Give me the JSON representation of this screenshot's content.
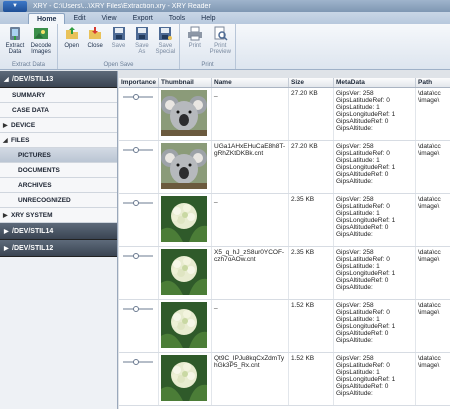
{
  "window": {
    "title": "XRY - C:\\Users\\...\\XRY Files\\Extraction.xry - XRY Reader"
  },
  "tabs": [
    {
      "label": "Home",
      "active": true
    },
    {
      "label": "Edit"
    },
    {
      "label": "View"
    },
    {
      "label": "Export"
    },
    {
      "label": "Tools"
    },
    {
      "label": "Help"
    }
  ],
  "ribbon": {
    "extract_group": {
      "label": "Extract Data",
      "buttons": [
        {
          "label": "Extract Data",
          "icon": "extract-data-icon"
        },
        {
          "label": "Decode Images",
          "icon": "decode-images-icon"
        }
      ]
    },
    "opensave_group": {
      "label": "Open Save",
      "buttons": [
        {
          "label": "Open",
          "icon": "open-icon"
        },
        {
          "label": "Close",
          "icon": "close-icon"
        },
        {
          "label": "Save",
          "icon": "save-icon"
        },
        {
          "label": "Save As",
          "icon": "save-as-icon"
        },
        {
          "label": "Save Special",
          "icon": "save-special-icon"
        }
      ]
    },
    "print_group": {
      "label": "Print",
      "buttons": [
        {
          "label": "Print",
          "icon": "print-icon"
        },
        {
          "label": "Print Preview",
          "icon": "print-preview-icon"
        }
      ]
    }
  },
  "sidebar": {
    "device_top": "/DEV/STIL13",
    "items": [
      {
        "label": "SUMMARY"
      },
      {
        "label": "CASE DATA"
      },
      {
        "label": "DEVICE"
      },
      {
        "label": "FILES"
      },
      {
        "label": "PICTURES"
      },
      {
        "label": "DOCUMENTS"
      },
      {
        "label": "ARCHIVES"
      },
      {
        "label": "UNRECOGNIZED"
      },
      {
        "label": "XRY SYSTEM"
      }
    ],
    "devices_bottom": [
      "/DEV/STIL14",
      "/DEV/STIL12"
    ]
  },
  "table": {
    "headers": [
      "Importance",
      "Thumbnail",
      "Name",
      "Size",
      "MetaData",
      "Path"
    ],
    "rows": [
      {
        "name": "_",
        "size": "27.20 KB",
        "thumb": "koala",
        "meta": [
          "GipsVer: 258",
          "GipsLatitudeRef: 0",
          "GipsLatitude: 1",
          "GipsLongitudeRef: 1",
          "GipsAltitudeRef: 0",
          "GipsAltitude:"
        ],
        "path": [
          "\\data\\cc",
          "\\image\\"
        ]
      },
      {
        "name": "UGa1AHxEHuCaE8h8T-gRhZKtDKBk.cnt",
        "size": "27.20 KB",
        "thumb": "koala",
        "meta": [
          "GipsVer: 258",
          "GipsLatitudeRef: 0",
          "GipsLatitude: 1",
          "GipsLongitudeRef: 1",
          "GipsAltitudeRef: 0",
          "GipsAltitude:"
        ],
        "path": [
          "\\data\\cc",
          "\\image\\"
        ]
      },
      {
        "name": "_",
        "size": "2.35 KB",
        "thumb": "flower",
        "meta": [
          "GipsVer: 258",
          "GipsLatitudeRef: 0",
          "GipsLatitude: 1",
          "GipsLongitudeRef: 1",
          "GipsAltitudeRef: 0",
          "GipsAltitude:"
        ],
        "path": [
          "\\data\\cc",
          "\\image\\"
        ]
      },
      {
        "name": "X5_q_hJ_zS8ur0YCOF-czh7oAOw.cnt",
        "size": "2.35 KB",
        "thumb": "flower",
        "meta": [
          "GipsVer: 258",
          "GipsLatitudeRef: 0",
          "GipsLatitude: 1",
          "GipsLongitudeRef: 1",
          "GipsAltitudeRef: 0",
          "GipsAltitude:"
        ],
        "path": [
          "\\data\\cc",
          "\\image\\"
        ]
      },
      {
        "name": "_",
        "size": "1.52 KB",
        "thumb": "flower",
        "meta": [
          "GipsVer: 258",
          "GipsLatitudeRef: 0",
          "GipsLatitude: 1",
          "GipsLongitudeRef: 1",
          "GipsAltitudeRef: 0",
          "GipsAltitude:"
        ],
        "path": [
          "\\data\\cc",
          "\\image\\"
        ]
      },
      {
        "name": "Qt9C_IPJu8kqCxZdmTyhGk3P5_Rx.cnt",
        "size": "1.52 KB",
        "thumb": "flower",
        "meta": [
          "GipsVer: 258",
          "GipsLatitudeRef: 0",
          "GipsLatitude: 1",
          "GipsLongitudeRef: 1",
          "GipsAltitudeRef: 0",
          "GipsAltitude:"
        ],
        "path": [
          "\\data\\cc",
          "\\image\\"
        ]
      }
    ]
  }
}
